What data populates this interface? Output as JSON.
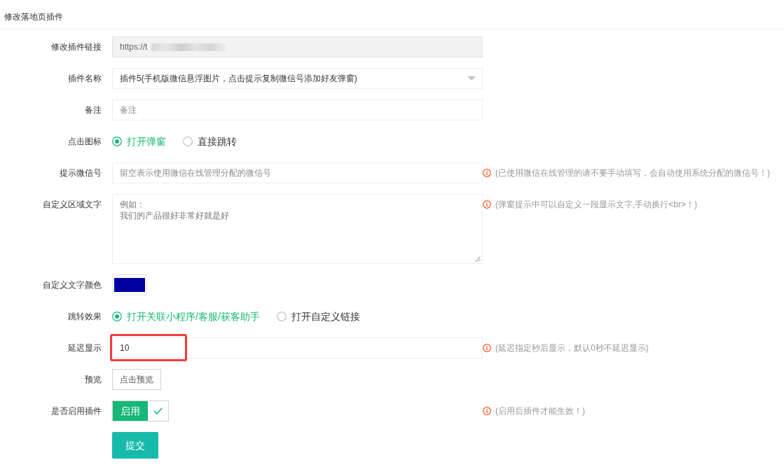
{
  "header": {
    "title": "修改落地页插件"
  },
  "rows": [
    {
      "kind": "input",
      "label": "修改插件链接",
      "value": "https://t",
      "disabled": true,
      "redacted": true,
      "highlighted": false
    },
    {
      "kind": "select",
      "label": "插件名称",
      "value": "插件5(手机版微信悬浮图片，点击提示复制微信号添加好友弹窗)"
    },
    {
      "kind": "input",
      "label": "备注",
      "placeholder": "备注",
      "disabled": false,
      "redacted": false,
      "highlighted": false
    },
    {
      "kind": "radio",
      "label": "点击图标",
      "options": [
        {
          "label": "打开弹窗",
          "selected": true
        },
        {
          "label": "直接跳转",
          "selected": false
        }
      ]
    },
    {
      "kind": "input",
      "label": "提示微信号",
      "placeholder": "留空表示使用微信在线管理分配的微信号",
      "disabled": false,
      "redacted": false,
      "highlighted": false,
      "tip": "(已使用微信在线管理的请不要手动填写，会自动使用系统分配的微信号！)"
    },
    {
      "kind": "textarea",
      "label": "自定义区域文字",
      "placeholder": [
        "例如：",
        "我们的产品很好非常好就是好"
      ],
      "tip": "(弹窗提示中可以自定义一段显示文字,手动换行<br>！)"
    },
    {
      "kind": "color",
      "label": "自定义文字颜色",
      "color": "#0000a0"
    },
    {
      "kind": "radio",
      "label": "跳转效果",
      "options": [
        {
          "label": "打开关联小程序/客服/获客助手",
          "selected": true
        },
        {
          "label": "打开自定义链接",
          "selected": false
        }
      ]
    },
    {
      "kind": "input",
      "label": "延迟显示",
      "value": "10",
      "disabled": false,
      "redacted": false,
      "highlighted": true,
      "tip": "(延迟指定秒后显示，默认0秒不延迟显示)"
    },
    {
      "kind": "button",
      "label": "预览",
      "button": "点击预览"
    },
    {
      "kind": "toggle",
      "label": "是否启用插件",
      "toggle": {
        "label": "启用",
        "on": true
      },
      "tip": "(启用后插件才能生效！)"
    },
    {
      "kind": "submit",
      "button": "提交"
    }
  ]
}
